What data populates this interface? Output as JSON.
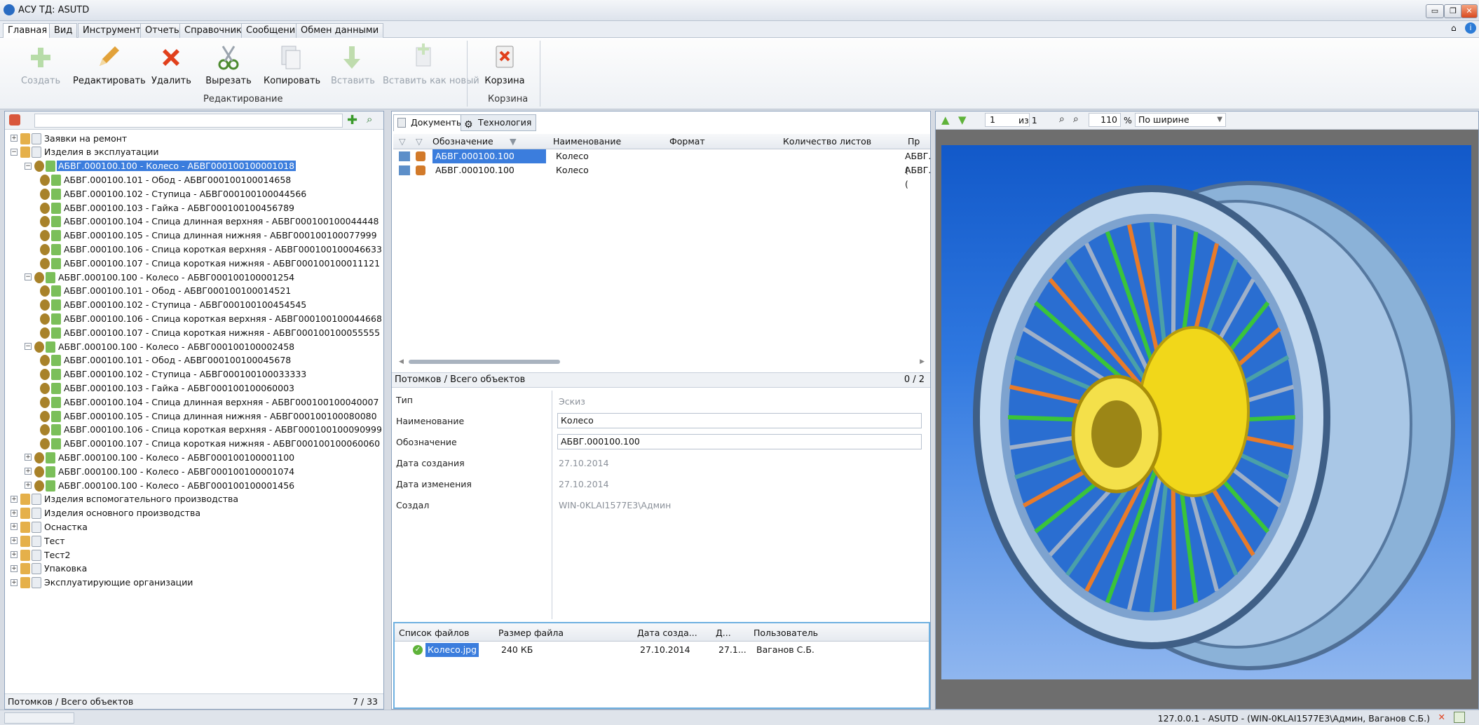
{
  "window": {
    "title": "АСУ ТД: ASUTD"
  },
  "menu": {
    "tabs": [
      "Главная",
      "Вид",
      "Инструменты",
      "Отчеты",
      "Справочники",
      "Сообщения",
      "Обмен данными"
    ]
  },
  "ribbon": {
    "buttons": [
      "Создать",
      "Редактировать",
      "Удалить",
      "Вырезать",
      "Копировать",
      "Вставить",
      "Вставить как новый",
      "Корзина"
    ],
    "groups": {
      "edit": "Редактирование",
      "trash": "Корзина"
    }
  },
  "tree": {
    "rows": [
      "Заявки на ремонт",
      "Изделия в эксплуатации",
      "АБВГ.000100.100 - Колесо - АБВГ000100100001018",
      "АБВГ.000100.101 - Обод - АБВГ000100100014658",
      "АБВГ.000100.102 - Ступица - АБВГ000100100044566",
      "АБВГ.000100.103 - Гайка - АБВГ000100100456789",
      "АБВГ.000100.104 - Спица длинная верхняя - АБВГ000100100044448",
      "АБВГ.000100.105 - Спица длинная нижняя - АБВГ000100100077999",
      "АБВГ.000100.106 - Спица короткая верхняя - АБВГ000100100046633",
      "АБВГ.000100.107 - Спица короткая нижняя - АБВГ000100100011121",
      "АБВГ.000100.100 - Колесо - АБВГ000100100001254",
      "АБВГ.000100.101 - Обод - АБВГ000100100014521",
      "АБВГ.000100.102 - Ступица - АБВГ000100100454545",
      "АБВГ.000100.106 - Спица короткая верхняя - АБВГ000100100044668",
      "АБВГ.000100.107 - Спица короткая нижняя - АБВГ000100100055555",
      "АБВГ.000100.100 - Колесо - АБВГ000100100002458",
      "АБВГ.000100.101 - Обод - АБВГ000100100045678",
      "АБВГ.000100.102 - Ступица - АБВГ000100100033333",
      "АБВГ.000100.103 - Гайка - АБВГ000100100060003",
      "АБВГ.000100.104 - Спица длинная верхняя - АБВГ000100100040007",
      "АБВГ.000100.105 - Спица длинная нижняя - АБВГ000100100080080",
      "АБВГ.000100.106 - Спица короткая верхняя - АБВГ000100100090999",
      "АБВГ.000100.107 - Спица короткая нижняя - АБВГ000100100060060",
      "АБВГ.000100.100 - Колесо - АБВГ000100100001100",
      "АБВГ.000100.100 - Колесо - АБВГ000100100001074",
      "АБВГ.000100.100 - Колесо - АБВГ000100100001456",
      "Изделия вспомогательного производства",
      "Изделия основного производства",
      "Оснастка",
      "Тест",
      "Тест2",
      "Упаковка",
      "Эксплуатирующие организации"
    ],
    "status_label": "Потомков / Всего объектов",
    "status_count": "7 / 33"
  },
  "documents": {
    "tabs": [
      "Документы",
      "Технология"
    ],
    "columns": [
      "Обозначение",
      "Наименование",
      "Формат",
      "Количество листов",
      "Пр"
    ],
    "rows": [
      {
        "designation": "АБВГ.000100.100",
        "name": "Колесо",
        "extra": "АБВГ.("
      },
      {
        "designation": "АБВГ.000100.100",
        "name": "Колесо",
        "extra": "АБВГ.("
      }
    ],
    "status_label": "Потомков / Всего объектов",
    "status_count": "0 / 2"
  },
  "properties": {
    "type_label": "Тип",
    "type_value": "Эскиз",
    "name_label": "Наименование",
    "name_value": "Колесо",
    "designation_label": "Обозначение",
    "designation_value": "АБВГ.000100.100",
    "created_label": "Дата создания",
    "created_value": "27.10.2014",
    "modified_label": "Дата изменения",
    "modified_value": "27.10.2014",
    "author_label": "Создал",
    "author_value": "WIN-0KLAI1577E3\\Админ"
  },
  "files": {
    "columns": [
      "Список файлов",
      "Размер файла",
      "Дата созда...",
      "Д...",
      "Пользователь"
    ],
    "row": {
      "name": "Колесо.jpg",
      "size": "240 КБ",
      "date": "27.10.2014",
      "d": "27.1...",
      "user": "Ваганов С.Б."
    }
  },
  "viewer": {
    "page": "1",
    "of": "из 1",
    "zoom": "110",
    "zoom_unit": "%",
    "fit": "По ширине"
  },
  "statusbar": {
    "text": "127.0.0.1 - ASUTD - (WIN-0KLAI1577E3\\Админ, Ваганов С.Б.)"
  }
}
